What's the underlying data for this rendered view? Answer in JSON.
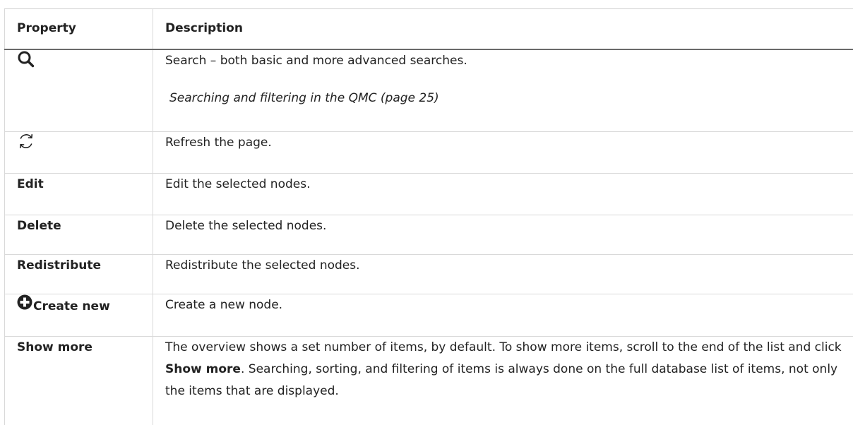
{
  "table": {
    "headers": {
      "property": "Property",
      "description": "Description"
    },
    "rows": [
      {
        "property_icon": "search-icon",
        "description": "Search – both basic and more advanced searches.",
        "link": "Searching and filtering in the QMC (page 25)"
      },
      {
        "property_icon": "refresh-icon",
        "description": "Refresh the page."
      },
      {
        "property": "Edit",
        "description": "Edit the selected nodes."
      },
      {
        "property": "Delete",
        "description": "Delete the selected nodes."
      },
      {
        "property": "Redistribute",
        "description": "Redistribute the selected nodes."
      },
      {
        "property_icon": "plus-circle-icon",
        "property": "Create new",
        "description": "Create a new node."
      },
      {
        "property": "Show more",
        "description_parts": {
          "before": "The overview shows a set number of items, by default. To show more items, scroll to the end of the list and click ",
          "bold": "Show more",
          "after": ". Searching, sorting, and filtering of items is always done on the full database list of items, not only the items that are displayed."
        }
      }
    ]
  }
}
